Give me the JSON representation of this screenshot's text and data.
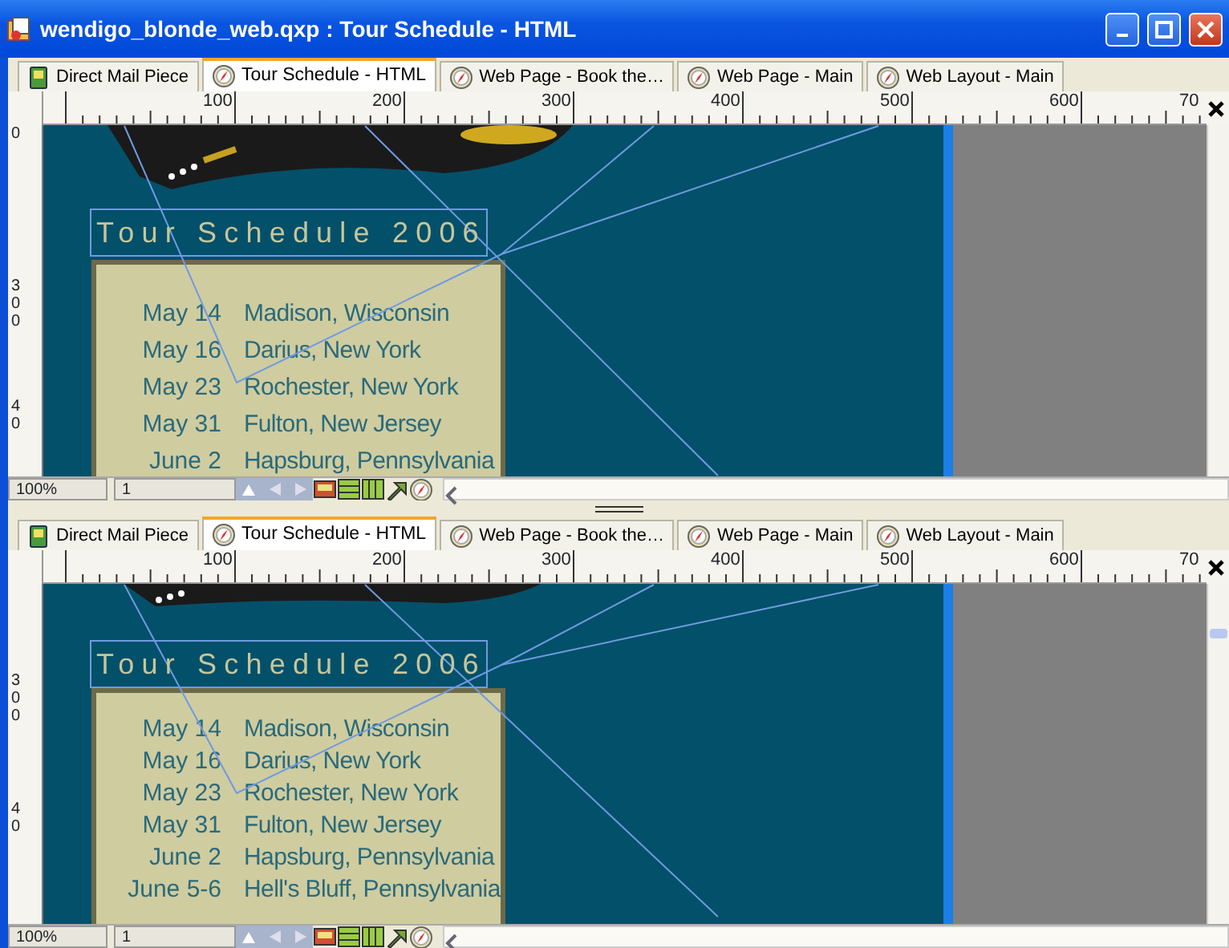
{
  "window": {
    "title": "wendigo_blonde_web.qxp : Tour Schedule - HTML"
  },
  "panes": [
    {
      "tabs": [
        {
          "label": "Direct Mail Piece",
          "kind": "print",
          "selected": false
        },
        {
          "label": "Tour Schedule - HTML",
          "kind": "web",
          "selected": true
        },
        {
          "label": "Web Page - Book the…",
          "kind": "web",
          "selected": false
        },
        {
          "label": "Web Page - Main",
          "kind": "web",
          "selected": false
        },
        {
          "label": "Web Layout - Main",
          "kind": "web",
          "selected": false
        }
      ],
      "ruler_labels": [
        "100",
        "200",
        "300",
        "400",
        "500",
        "600",
        "70"
      ],
      "vertical_ruler_labels": [
        "0",
        "300",
        "40"
      ],
      "heading": "Tour Schedule 2006",
      "schedule": [
        {
          "date": "May 14",
          "place": "Madison, Wisconsin"
        },
        {
          "date": "May 16",
          "place": "Darius, New York"
        },
        {
          "date": "May 23",
          "place": "Rochester, New York"
        },
        {
          "date": "May 31",
          "place": "Fulton, New Jersey"
        },
        {
          "date": "June 2",
          "place": "Hapsburg, Pennsylvania"
        }
      ],
      "zoom": "100%",
      "page": "1"
    },
    {
      "tabs": [
        {
          "label": "Direct Mail Piece",
          "kind": "print",
          "selected": false
        },
        {
          "label": "Tour Schedule - HTML",
          "kind": "web",
          "selected": true
        },
        {
          "label": "Web Page - Book the…",
          "kind": "web",
          "selected": false
        },
        {
          "label": "Web Page - Main",
          "kind": "web",
          "selected": false
        },
        {
          "label": "Web Layout - Main",
          "kind": "web",
          "selected": false
        }
      ],
      "ruler_labels": [
        "100",
        "200",
        "300",
        "400",
        "500",
        "600",
        "70"
      ],
      "vertical_ruler_labels": [
        "300",
        "40"
      ],
      "heading": "Tour Schedule 2006",
      "schedule": [
        {
          "date": "May 14",
          "place": "Madison, Wisconsin"
        },
        {
          "date": "May 16",
          "place": "Darius, New York"
        },
        {
          "date": "May 23",
          "place": "Rochester, New York"
        },
        {
          "date": "May 31",
          "place": "Fulton, New Jersey"
        },
        {
          "date": "June 2",
          "place": "Hapsburg, Pennsylvania"
        },
        {
          "date": "June 5-6",
          "place": "Hell's Bluff, Pennsylvania"
        }
      ],
      "zoom": "100%",
      "page": "1"
    }
  ]
}
